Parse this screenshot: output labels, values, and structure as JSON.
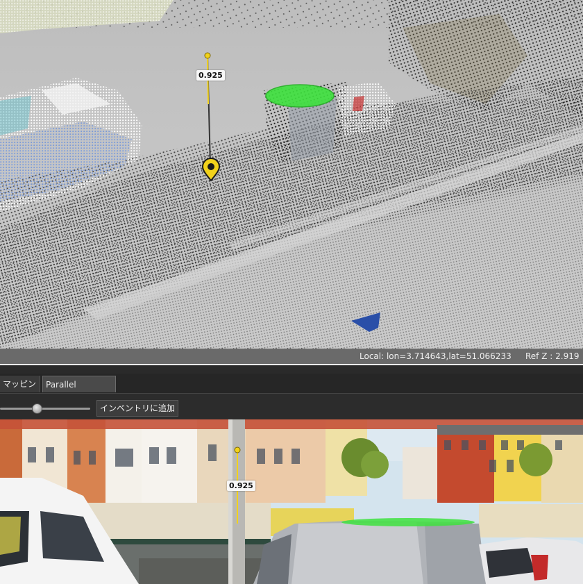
{
  "viewport": {
    "height_label": "0.925",
    "status": {
      "coords": "Local: lon=3.714643,lat=51.066233",
      "ref_z": "Ref Z : 2.919"
    }
  },
  "tabs": [
    {
      "label": "マッピング"
    },
    {
      "label": "Parallel Extraction"
    }
  ],
  "toolbar": {
    "slider_value": 0.4,
    "add_inventory_label": "インベントリに追加"
  },
  "photo": {
    "height_label": "0.925"
  },
  "colors": {
    "marker_yellow": "#f2d21b",
    "selection_green": "#3ee23e",
    "camera_blue": "#2a4fa8"
  }
}
